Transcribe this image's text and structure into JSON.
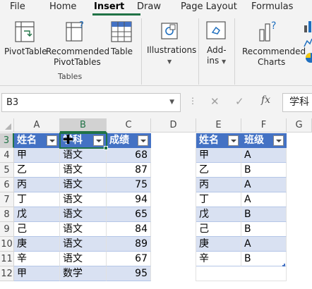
{
  "ribbon_tabs": [
    "File",
    "Home",
    "Insert",
    "Draw",
    "Page Layout",
    "Formulas"
  ],
  "active_tab": "Insert",
  "ribbon": {
    "pivot_table": "PivotTable",
    "recommended_pivot_line1": "Recommended",
    "recommended_pivot_line2": "PivotTables",
    "table": "Table",
    "illustrations": "Illustrations",
    "addins_line1": "Add-",
    "addins_line2": "ins",
    "recommended_charts_line1": "Recommended",
    "recommended_charts_line2": "Charts",
    "group_tables": "Tables"
  },
  "formula_bar": {
    "name_box": "B3",
    "fx": "fx",
    "content": "学科"
  },
  "columns": [
    "A",
    "B",
    "C",
    "D",
    "E",
    "F",
    "G"
  ],
  "rows": [
    "3",
    "4",
    "5",
    "6",
    "7",
    "8",
    "9",
    "10",
    "11",
    "12"
  ],
  "table1": {
    "headers": [
      "姓名",
      "学科",
      "成绩"
    ],
    "rows": [
      [
        "甲",
        "语文",
        "68"
      ],
      [
        "乙",
        "语文",
        "87"
      ],
      [
        "丙",
        "语文",
        "75"
      ],
      [
        "丁",
        "语文",
        "94"
      ],
      [
        "戊",
        "语文",
        "65"
      ],
      [
        "己",
        "语文",
        "84"
      ],
      [
        "庚",
        "语文",
        "89"
      ],
      [
        "辛",
        "语文",
        "67"
      ],
      [
        "甲",
        "数学",
        "95"
      ]
    ]
  },
  "table2": {
    "headers": [
      "姓名",
      "班级"
    ],
    "rows": [
      [
        "甲",
        "A"
      ],
      [
        "乙",
        "B"
      ],
      [
        "丙",
        "A"
      ],
      [
        "丁",
        "A"
      ],
      [
        "戊",
        "B"
      ],
      [
        "己",
        "B"
      ],
      [
        "庚",
        "A"
      ],
      [
        "辛",
        "B"
      ]
    ]
  },
  "colors": {
    "accent": "#217346",
    "table_header": "#4472c4",
    "table_band": "#d9e1f2"
  }
}
